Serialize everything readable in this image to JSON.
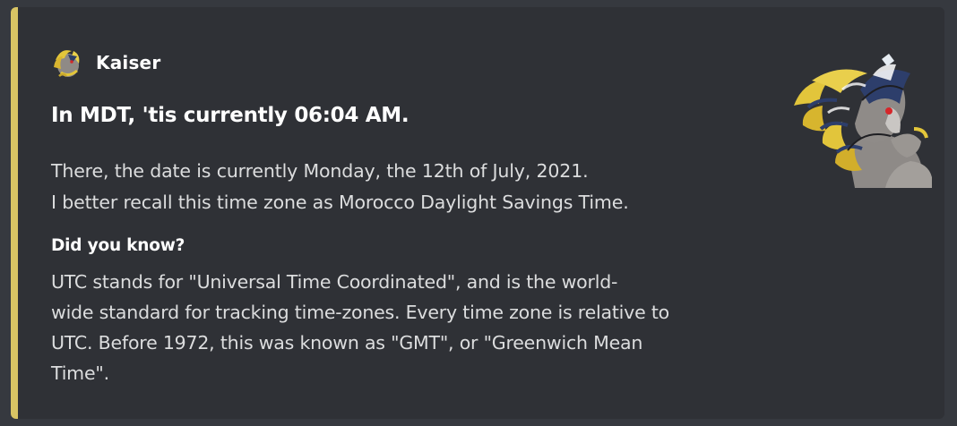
{
  "embed": {
    "accent_color": "#d8c464",
    "author": {
      "name": "Kaiser",
      "icon": "avatar-icon"
    },
    "title": "In MDT, 'tis currently 06:04 AM.",
    "description": [
      "There, the date is currently Monday, the 12th of July, 2021.",
      "I better recall this time zone as Morocco Daylight Savings Time."
    ],
    "field": {
      "name": "Did you know?",
      "value_lines": [
        "UTC stands for \"Universal Time Coordinated\", and is the world-",
        "wide standard for tracking time-zones. Every time zone is relative to",
        "UTC. Before 1972, this was known as \"GMT\", or \"Greenwich Mean",
        "Time\"."
      ]
    },
    "thumbnail": {
      "icon": "character-thumbnail-icon"
    }
  }
}
